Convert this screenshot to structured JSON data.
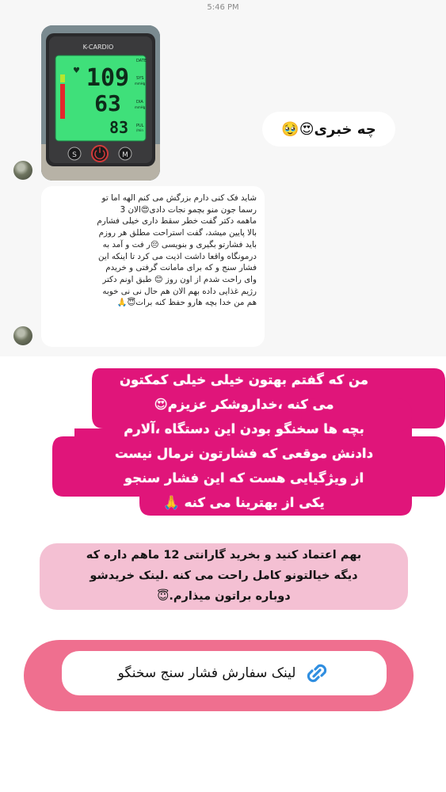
{
  "chat": {
    "timestamp": "5:46 PM",
    "photo": {
      "device_brand": "K-CARDIO",
      "sys": "109",
      "dia": "63",
      "pulse": "83",
      "labels": {
        "date": "DATE",
        "sys": "SYS",
        "sys_unit": "mmHg",
        "dia": "DIA",
        "dia_unit": "mmHg",
        "pul": "PUL",
        "pul_unit": "/min"
      },
      "buttons": {
        "set": "S",
        "memory": "M"
      }
    },
    "sent_message": "چه خبری😍🥹",
    "received_message": "شاید فک کنی دارم بزرگش می کنم الهه اما تو\nرسما جون  منو بچمو  نجات دادی😍الان 3\nماهمه دکتر گفت خطر سقط داری خیلی فشارم\nبالا پایین میشد، گفت استراحت مطلق هر روزم\nباید  فشارتو بگیری و بنویسی 😔ر فت و آمد به\nدرمونگاه واقعا داشت اذیت می کرد تا اینکه این\nفشار سنج و که برای مامانت گرفتی و خریدم\nوای راحت شدم از اون روز 😊 طبق اونم دکتر\nرژیم غذایی داده بهم الان هم حال نی نی خوبه\nهم من خدا بچه هارو حفظ کنه برات😇🙏"
  },
  "story": {
    "main_text": "من که گفتم بهتون خیلی خیلی کمکتون\nمی کنه ،خداروشکر عزیزم😍\nبچه ها سخنگو بودن این دستگاه ،آلارم\nدادنش موقعی که فشارتون نرمال نیست\nاز ویژگیایی هست که  این فشار سنجو\nیکی از بهترینا می کنه 🙏",
    "secondary_text": "بهم اعتماد کنید و بخرید گارانتی 12 ماهم داره که\nدیگه خیالتونو کامل راحت می کنه .لینک خریدشو\nدوباره براتون میذارم.😇",
    "link_label": "لینک سفارش  فشار سنج سخنگو"
  },
  "colors": {
    "magenta": "#e0157a",
    "pink_light": "#f4c0d3",
    "link_outer": "#ef6f8f",
    "display_green": "#3fe07a",
    "link_blue": "#2f8ee0"
  }
}
